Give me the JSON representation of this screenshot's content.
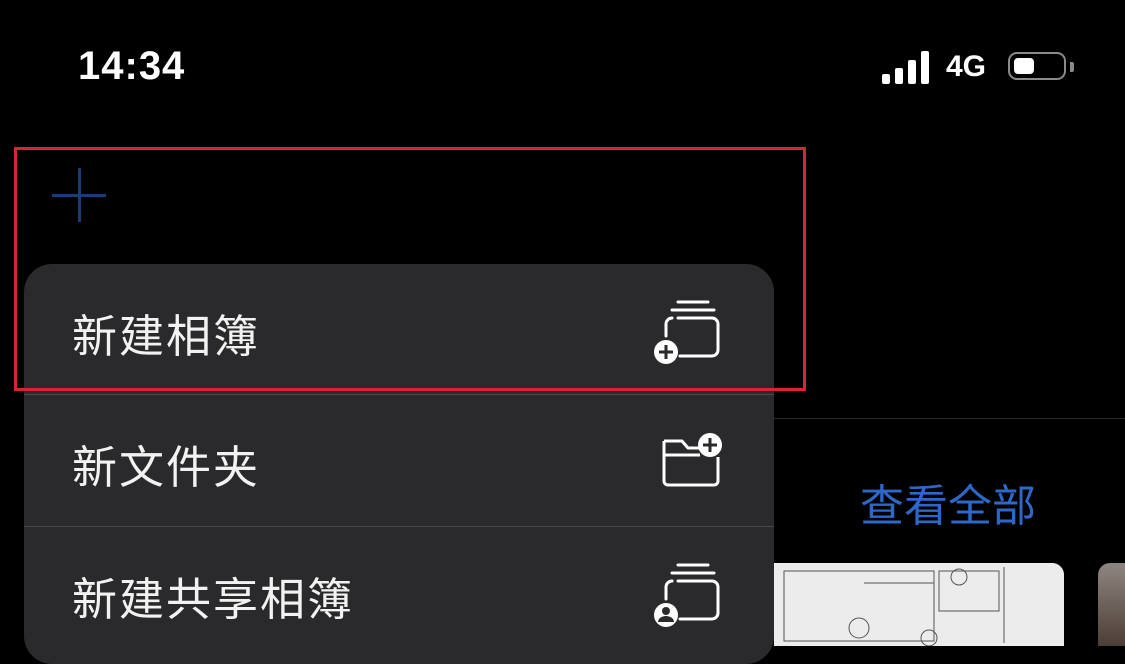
{
  "status_bar": {
    "time": "14:34",
    "network": "4G",
    "battery_level": 0.4
  },
  "toolbar": {
    "add_icon": "plus-icon"
  },
  "menu": {
    "items": [
      {
        "label": "新建相簿",
        "icon": "new-album-icon"
      },
      {
        "label": "新文件夹",
        "icon": "new-folder-icon"
      },
      {
        "label": "新建共享相簿",
        "icon": "new-shared-album-icon"
      }
    ]
  },
  "background": {
    "view_all": "查看全部"
  },
  "colors": {
    "accent": "#2d68c9",
    "menu_bg": "#2a2a2c",
    "highlight": "#d6262f"
  }
}
